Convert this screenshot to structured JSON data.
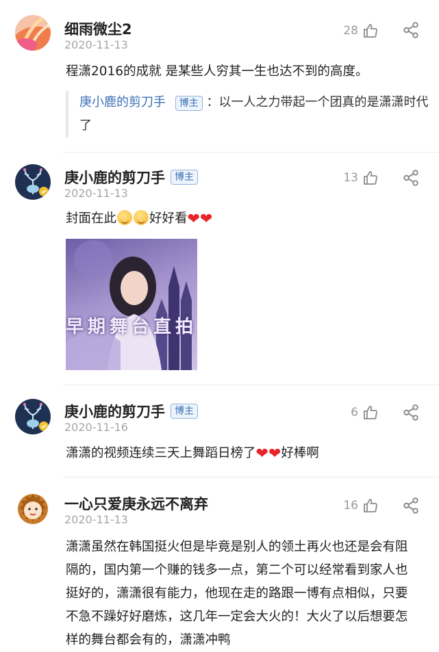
{
  "comments": [
    {
      "username": "细雨微尘2",
      "date": "2020-11-13",
      "likes": "28",
      "text": "程潇2016的成就 是某些人穷其一生也达不到的高度。",
      "reply": {
        "username": "庚小鹿的剪刀手",
        "badge": "博主",
        "text_line1": "：以一人之力带起一个团真的是潇潇时代",
        "text_line2": "了"
      }
    },
    {
      "username": "庚小鹿的剪刀手",
      "badge": "博主",
      "date": "2020-11-13",
      "likes": "13",
      "text_before": "封面在此",
      "text_after": "好好看",
      "image_caption": "早期舞台直拍"
    },
    {
      "username": "庚小鹿的剪刀手",
      "badge": "博主",
      "date": "2020-11-16",
      "likes": "6",
      "text_before": "潇潇的视频连续三天上舞蹈日榜了",
      "text_after": "好棒啊"
    },
    {
      "username": "一心只爱庚永远不离弃",
      "date": "2020-11-13",
      "likes": "16",
      "lines": [
        "潇潇虽然在韩国挺火但是毕竟是别人的领土再火也还是会有阻",
        "隔的，国内第一个赚的钱多一点，第二个可以经常看到家人也",
        "挺好的，潇潇很有能力，他现在走的路跟一博有点相似，只要",
        "不急不躁好好磨炼，这几年一定会大火的！大火了以后想要怎",
        "样的舞台都会有的，潇潇冲鸭"
      ]
    }
  ],
  "colors": {
    "link": "#3a6fb5",
    "date": "#a5a5a5",
    "heart": "#e8232a"
  },
  "icons": [
    "thumbs-up-icon",
    "share-icon",
    "heart-emoji",
    "blush-emoji"
  ]
}
